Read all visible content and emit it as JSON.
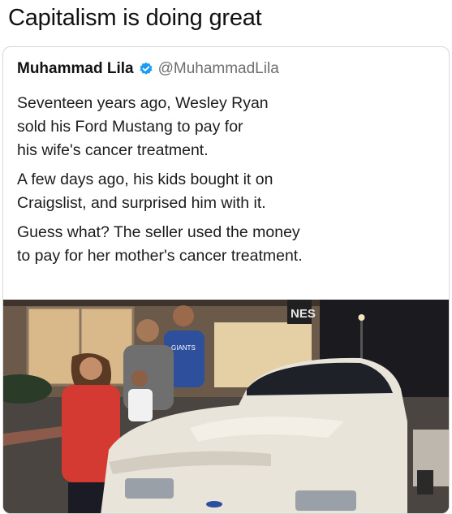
{
  "meme": {
    "caption": "Capitalism is doing great"
  },
  "tweet": {
    "author_name": "Muhammad Lila",
    "handle": "@MuhammadLila",
    "verified": true,
    "paragraphs": [
      {
        "lines": [
          "Seventeen years ago, Wesley Ryan",
          "sold his Ford Mustang to pay for",
          "his wife's cancer treatment."
        ]
      },
      {
        "lines": [
          "A few days ago, his kids bought it on",
          "Craigslist, and surprised him with it."
        ]
      },
      {
        "lines": [
          "Guess what? The seller used the money",
          "to pay for her mother's cancer treatment."
        ]
      }
    ]
  },
  "photo": {
    "store_sign_fragment": "NES",
    "shirt_text": "GIANTS"
  },
  "colors": {
    "verified_badge": "#1d9bf0",
    "handle": "#6e6e6e",
    "car": "#e9e4da",
    "night_sky": "#1a1a1f"
  }
}
